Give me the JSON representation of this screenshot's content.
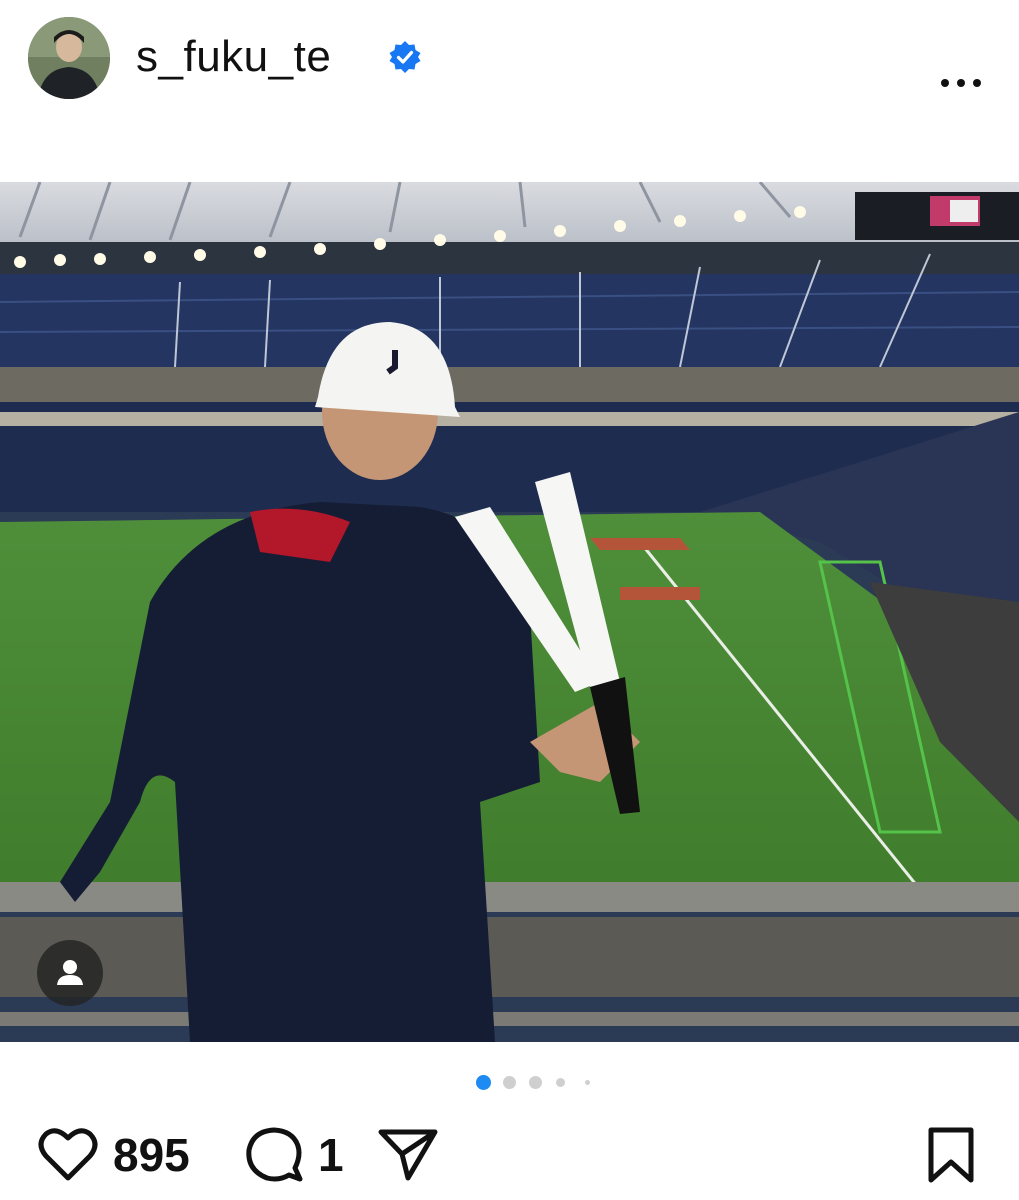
{
  "post": {
    "username": "s_fuku_te",
    "verified": true,
    "likes": "895",
    "comments": "1"
  },
  "carousel": {
    "total": 5,
    "active_index": 0
  },
  "icons": {
    "verified": "verified-badge-icon",
    "more": "more-options-icon",
    "like": "heart-icon",
    "comment": "comment-bubble-icon",
    "share": "paper-plane-icon",
    "save": "bookmark-icon",
    "tag": "user-tag-icon"
  },
  "colors": {
    "verified_blue": "#1877f2",
    "active_dot": "#1d8bf1",
    "inactive_dot": "#cfcfcf",
    "text": "#111111"
  }
}
